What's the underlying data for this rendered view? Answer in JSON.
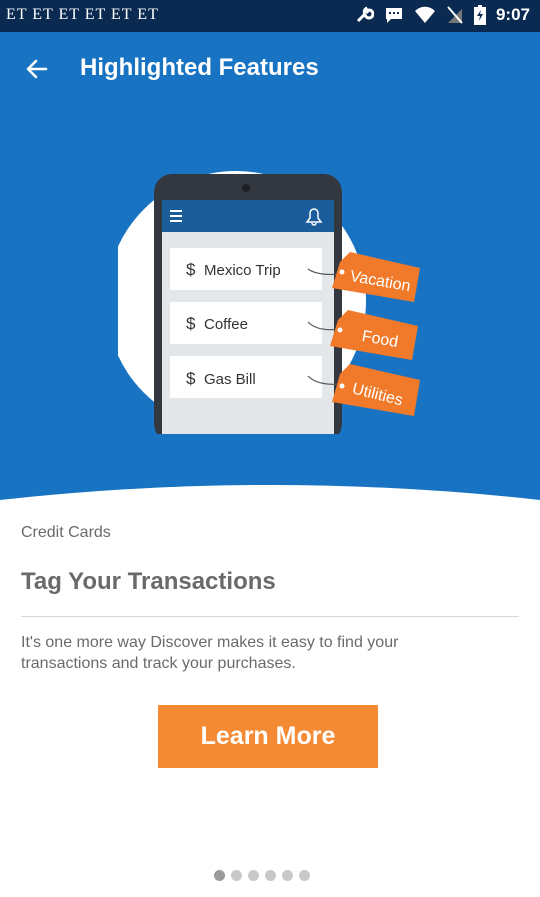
{
  "status_bar": {
    "left_text": "ET ET ET ET ET ET",
    "time": "9:07",
    "icons": [
      "wrench-icon",
      "chat-icon",
      "wifi-icon",
      "no-sim-icon",
      "battery-icon"
    ]
  },
  "toolbar": {
    "title": "Highlighted Features",
    "back_icon": "arrow-left-icon"
  },
  "illustration": {
    "list_items": [
      "Mexico Trip",
      "Coffee",
      "Gas Bill"
    ],
    "tags": [
      "Vacation",
      "Food",
      "Utilities"
    ],
    "currency_symbol": "$"
  },
  "feature": {
    "category": "Credit Cards",
    "headline": "Tag Your Transactions",
    "description": "It's one more way Discover makes it easy to find your transactions and track your purchases.",
    "button_label": "Learn More"
  },
  "pager": {
    "total": 6,
    "current": 1
  },
  "colors": {
    "hero_blue": "#1874c2",
    "status_bar": "#0a2a52",
    "accent_orange": "#f58a35",
    "text_gray": "#6a6a6a"
  }
}
